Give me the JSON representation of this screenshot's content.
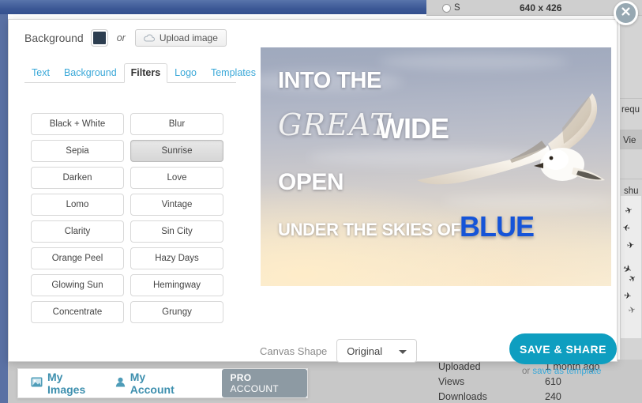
{
  "background_page": {
    "size_radio_label": "S",
    "dimensions": "640 x 426",
    "text_fragments": {
      "requ": "requ",
      "vie": "Vie",
      "shu": "shu"
    },
    "stats": [
      {
        "label": "Uploaded",
        "value": "1 month ago"
      },
      {
        "label": "Views",
        "value": "610"
      },
      {
        "label": "Downloads",
        "value": "240"
      }
    ]
  },
  "modal": {
    "background_row": {
      "label": "Background",
      "swatch_color": "#2d3e50",
      "swatch_icon": "color-swatch",
      "or_text": "or",
      "upload_label": "Upload image",
      "upload_icon": "cloud-upload-icon"
    },
    "tabs": [
      {
        "label": "Text",
        "active": false
      },
      {
        "label": "Background",
        "active": false
      },
      {
        "label": "Filters",
        "active": true
      },
      {
        "label": "Logo",
        "active": false
      },
      {
        "label": "Templates",
        "active": false
      }
    ],
    "filters": [
      {
        "label": "Black + White",
        "selected": false
      },
      {
        "label": "Blur",
        "selected": false
      },
      {
        "label": "Sepia",
        "selected": false
      },
      {
        "label": "Sunrise",
        "selected": true
      },
      {
        "label": "Darken",
        "selected": false
      },
      {
        "label": "Love",
        "selected": false
      },
      {
        "label": "Lomo",
        "selected": false
      },
      {
        "label": "Vintage",
        "selected": false
      },
      {
        "label": "Clarity",
        "selected": false
      },
      {
        "label": "Sin City",
        "selected": false
      },
      {
        "label": "Orange Peel",
        "selected": false
      },
      {
        "label": "Hazy Days",
        "selected": false
      },
      {
        "label": "Glowing Sun",
        "selected": false
      },
      {
        "label": "Hemingway",
        "selected": false
      },
      {
        "label": "Concentrate",
        "selected": false
      },
      {
        "label": "Grungy",
        "selected": false
      }
    ],
    "canvas": {
      "line_into": "INTO THE",
      "line_great": "GREAT",
      "line_wide": "WIDE",
      "line_open": "OPEN",
      "line_under": "UNDER THE SKIES OF",
      "line_blue": "BLUE",
      "blue_color": "#1554d8",
      "image_subject": "seagull-flying"
    },
    "canvas_shape": {
      "label": "Canvas Shape",
      "value": "Original"
    },
    "save": {
      "button_label": "SAVE & SHARE",
      "button_color": "#0e9ec0",
      "alt_prefix": "or ",
      "alt_link": "save as template"
    },
    "close_icon": "close-icon"
  },
  "footer": {
    "my_images": "My Images",
    "my_images_icon": "image-icon",
    "my_account": "My Account",
    "my_account_icon": "person-icon",
    "pro_badge_bold": "PRO",
    "pro_badge_rest": " ACCOUNT"
  }
}
